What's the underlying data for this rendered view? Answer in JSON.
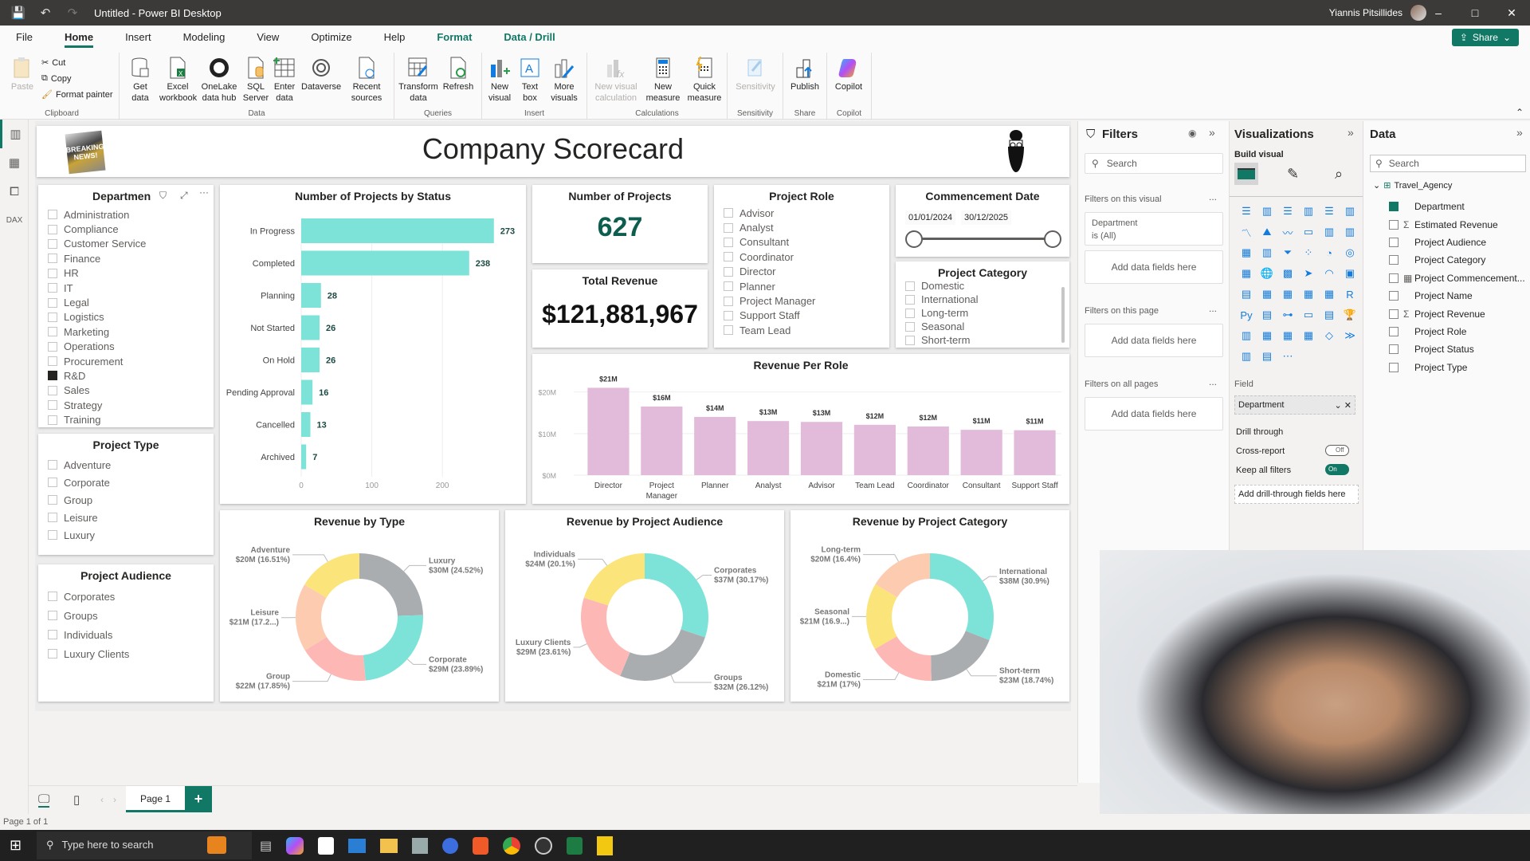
{
  "titlebar": {
    "title": "Untitled - Power BI Desktop",
    "user": "Yiannis Pitsillides",
    "minimize": "–",
    "maximize": "□",
    "close": "✕"
  },
  "menu": {
    "items": [
      "File",
      "Home",
      "Insert",
      "Modeling",
      "View",
      "Optimize",
      "Help",
      "Format",
      "Data / Drill"
    ],
    "active": "Home",
    "share_label": "Share"
  },
  "ribbon": {
    "clipboard": {
      "paste": "Paste",
      "cut": "Cut",
      "copy": "Copy",
      "format_painter": "Format painter",
      "group": "Clipboard"
    },
    "data": {
      "get_data": "Get data",
      "excel": "Excel workbook",
      "onelake": "OneLake data hub",
      "sql": "SQL Server",
      "enter_data": "Enter data",
      "dataverse": "Dataverse",
      "recent": "Recent sources",
      "group": "Data"
    },
    "queries": {
      "transform": "Transform data",
      "refresh": "Refresh",
      "group": "Queries"
    },
    "insert": {
      "new_visual": "New visual",
      "text_box": "Text box",
      "more_visuals": "More visuals",
      "group": "Insert"
    },
    "calculations": {
      "new_visual_calc": "New visual calculation",
      "new_measure": "New measure",
      "quick_measure": "Quick measure",
      "group": "Calculations"
    },
    "sensitivity": {
      "label": "Sensitivity",
      "group": "Sensitivity"
    },
    "share": {
      "publish": "Publish",
      "group": "Share"
    },
    "copilot": {
      "label": "Copilot",
      "group": "Copilot"
    }
  },
  "report": {
    "title": "Company Scorecard",
    "department_slicer": {
      "title": "Departmen",
      "items": [
        {
          "label": "Administration",
          "checked": false
        },
        {
          "label": "Compliance",
          "checked": false
        },
        {
          "label": "Customer Service",
          "checked": false
        },
        {
          "label": "Finance",
          "checked": false
        },
        {
          "label": "HR",
          "checked": false
        },
        {
          "label": "IT",
          "checked": false
        },
        {
          "label": "Legal",
          "checked": false
        },
        {
          "label": "Logistics",
          "checked": false
        },
        {
          "label": "Marketing",
          "checked": false
        },
        {
          "label": "Operations",
          "checked": false
        },
        {
          "label": "Procurement",
          "checked": false
        },
        {
          "label": "R&D",
          "checked": true
        },
        {
          "label": "Sales",
          "checked": false
        },
        {
          "label": "Strategy",
          "checked": false
        },
        {
          "label": "Training",
          "checked": false
        }
      ]
    },
    "project_type_slicer": {
      "title": "Project Type",
      "items": [
        "Adventure",
        "Corporate",
        "Group",
        "Leisure",
        "Luxury"
      ]
    },
    "project_audience_slicer": {
      "title": "Project Audience",
      "items": [
        "Corporates",
        "Groups",
        "Individuals",
        "Luxury Clients"
      ]
    },
    "kpi_projects": {
      "title": "Number of Projects",
      "value": "627"
    },
    "kpi_revenue": {
      "title": "Total Revenue",
      "value": "$121,881,967"
    },
    "project_role_slicer": {
      "title": "Project Role",
      "items": [
        "Advisor",
        "Analyst",
        "Consultant",
        "Coordinator",
        "Director",
        "Planner",
        "Project Manager",
        "Support Staff",
        "Team Lead"
      ]
    },
    "commencement_date": {
      "title": "Commencement Date",
      "start": "01/01/2024",
      "end": "30/12/2025"
    },
    "project_category_slicer": {
      "title": "Project Category",
      "items": [
        "Domestic",
        "International",
        "Long-term",
        "Seasonal",
        "Short-term"
      ]
    }
  },
  "chart_data": [
    {
      "type": "bar",
      "orientation": "horizontal",
      "title": "Number of Projects by Status",
      "categories": [
        "In Progress",
        "Completed",
        "Planning",
        "Not Started",
        "On Hold",
        "Pending Approval",
        "Cancelled",
        "Archived"
      ],
      "values": [
        273,
        238,
        28,
        26,
        26,
        16,
        13,
        7
      ],
      "xticks": [
        "0",
        "100",
        "200"
      ],
      "xlim": [
        0,
        280
      ],
      "color": "#7de3d9"
    },
    {
      "type": "bar",
      "title": "Revenue Per Role",
      "categories": [
        "Director",
        "Project Manager",
        "Planner",
        "Analyst",
        "Advisor",
        "Team Lead",
        "Coordinator",
        "Consultant",
        "Support Staff"
      ],
      "values": [
        21,
        16.5,
        14,
        13,
        12.8,
        12.1,
        11.7,
        10.9,
        10.8
      ],
      "labels": [
        "$21M",
        "$16M",
        "$14M",
        "$13M",
        "$13M",
        "$12M",
        "$12M",
        "$11M",
        "$11M"
      ],
      "yticks": [
        "$0M",
        "$10M",
        "$20M"
      ],
      "ylim": [
        0,
        23
      ],
      "color": "#e2bbda"
    },
    {
      "type": "pie",
      "donut": true,
      "title": "Revenue by Type",
      "slices": [
        {
          "name": "Luxury",
          "label": "$30M (24.52%)",
          "value": 24.52,
          "color": "#a9adb0"
        },
        {
          "name": "Corporate",
          "label": "$29M (23.89%)",
          "value": 23.89,
          "color": "#7de3d9"
        },
        {
          "name": "Group",
          "label": "$22M (17.85%)",
          "value": 17.85,
          "color": "#fdb8b5"
        },
        {
          "name": "Leisure",
          "label": "$21M (17.2...)",
          "value": 17.23,
          "color": "#fdcbb0"
        },
        {
          "name": "Adventure",
          "label": "$20M (16.51%)",
          "value": 16.51,
          "color": "#fbe57a"
        }
      ]
    },
    {
      "type": "pie",
      "donut": true,
      "title": "Revenue by Project Audience",
      "slices": [
        {
          "name": "Corporates",
          "label": "$37M (30.17%)",
          "value": 30.17,
          "color": "#7de3d9"
        },
        {
          "name": "Groups",
          "label": "$32M (26.12%)",
          "value": 26.12,
          "color": "#a9adb0"
        },
        {
          "name": "Luxury Clients",
          "label": "$29M (23.61%)",
          "value": 23.61,
          "color": "#fdb8b5"
        },
        {
          "name": "Individuals",
          "label": "$24M (20.1%)",
          "value": 20.1,
          "color": "#fbe57a"
        }
      ]
    },
    {
      "type": "pie",
      "donut": true,
      "title": "Revenue by Project Category",
      "slices": [
        {
          "name": "International",
          "label": "$38M (30.9%)",
          "value": 30.9,
          "color": "#7de3d9"
        },
        {
          "name": "Short-term",
          "label": "$23M (18.74%)",
          "value": 18.74,
          "color": "#a9adb0"
        },
        {
          "name": "Domestic",
          "label": "$21M (17%)",
          "value": 17,
          "color": "#fdb8b5"
        },
        {
          "name": "Seasonal",
          "label": "$21M (16.9...)",
          "value": 16.96,
          "color": "#fbe57a"
        },
        {
          "name": "Long-term",
          "label": "$20M (16.4%)",
          "value": 16.4,
          "color": "#fdcbb0"
        }
      ]
    }
  ],
  "filters_pane": {
    "title": "Filters",
    "search_placeholder": "Search",
    "on_visual": "Filters on this visual",
    "visual_filter_field": "Department",
    "visual_filter_value": "is (All)",
    "add_fields": "Add data fields here",
    "on_page": "Filters on this page",
    "on_all": "Filters on all pages",
    "more": "..."
  },
  "viz_pane": {
    "title": "Visualizations",
    "build_visual": "Build visual",
    "field_label": "Field",
    "field_value": "Department",
    "drill_through": "Drill through",
    "cross_report": "Cross-report",
    "cross_report_state": "Off",
    "keep_filters": "Keep all filters",
    "keep_filters_state": "On",
    "add_drill": "Add drill-through fields here",
    "more": "..."
  },
  "data_pane": {
    "title": "Data",
    "search_placeholder": "Search",
    "table": "Travel_Agency",
    "fields": [
      {
        "name": "Department",
        "checked": true,
        "icon": ""
      },
      {
        "name": "Estimated Revenue",
        "checked": false,
        "icon": "Σ"
      },
      {
        "name": "Project Audience",
        "checked": false,
        "icon": ""
      },
      {
        "name": "Project Category",
        "checked": false,
        "icon": ""
      },
      {
        "name": "Project Commencement...",
        "checked": false,
        "icon": "calendar"
      },
      {
        "name": "Project Name",
        "checked": false,
        "icon": ""
      },
      {
        "name": "Project Revenue",
        "checked": false,
        "icon": "Σ"
      },
      {
        "name": "Project Role",
        "checked": false,
        "icon": ""
      },
      {
        "name": "Project Status",
        "checked": false,
        "icon": ""
      },
      {
        "name": "Project Type",
        "checked": false,
        "icon": ""
      }
    ]
  },
  "pages": {
    "tabs": [
      "Page 1"
    ],
    "add": "+",
    "status": "Page 1 of 1"
  },
  "taskbar": {
    "search_placeholder": "Type here to search"
  },
  "colors": {
    "accent": "#117865",
    "teal": "#7de3d9",
    "pink": "#e2bbda"
  }
}
